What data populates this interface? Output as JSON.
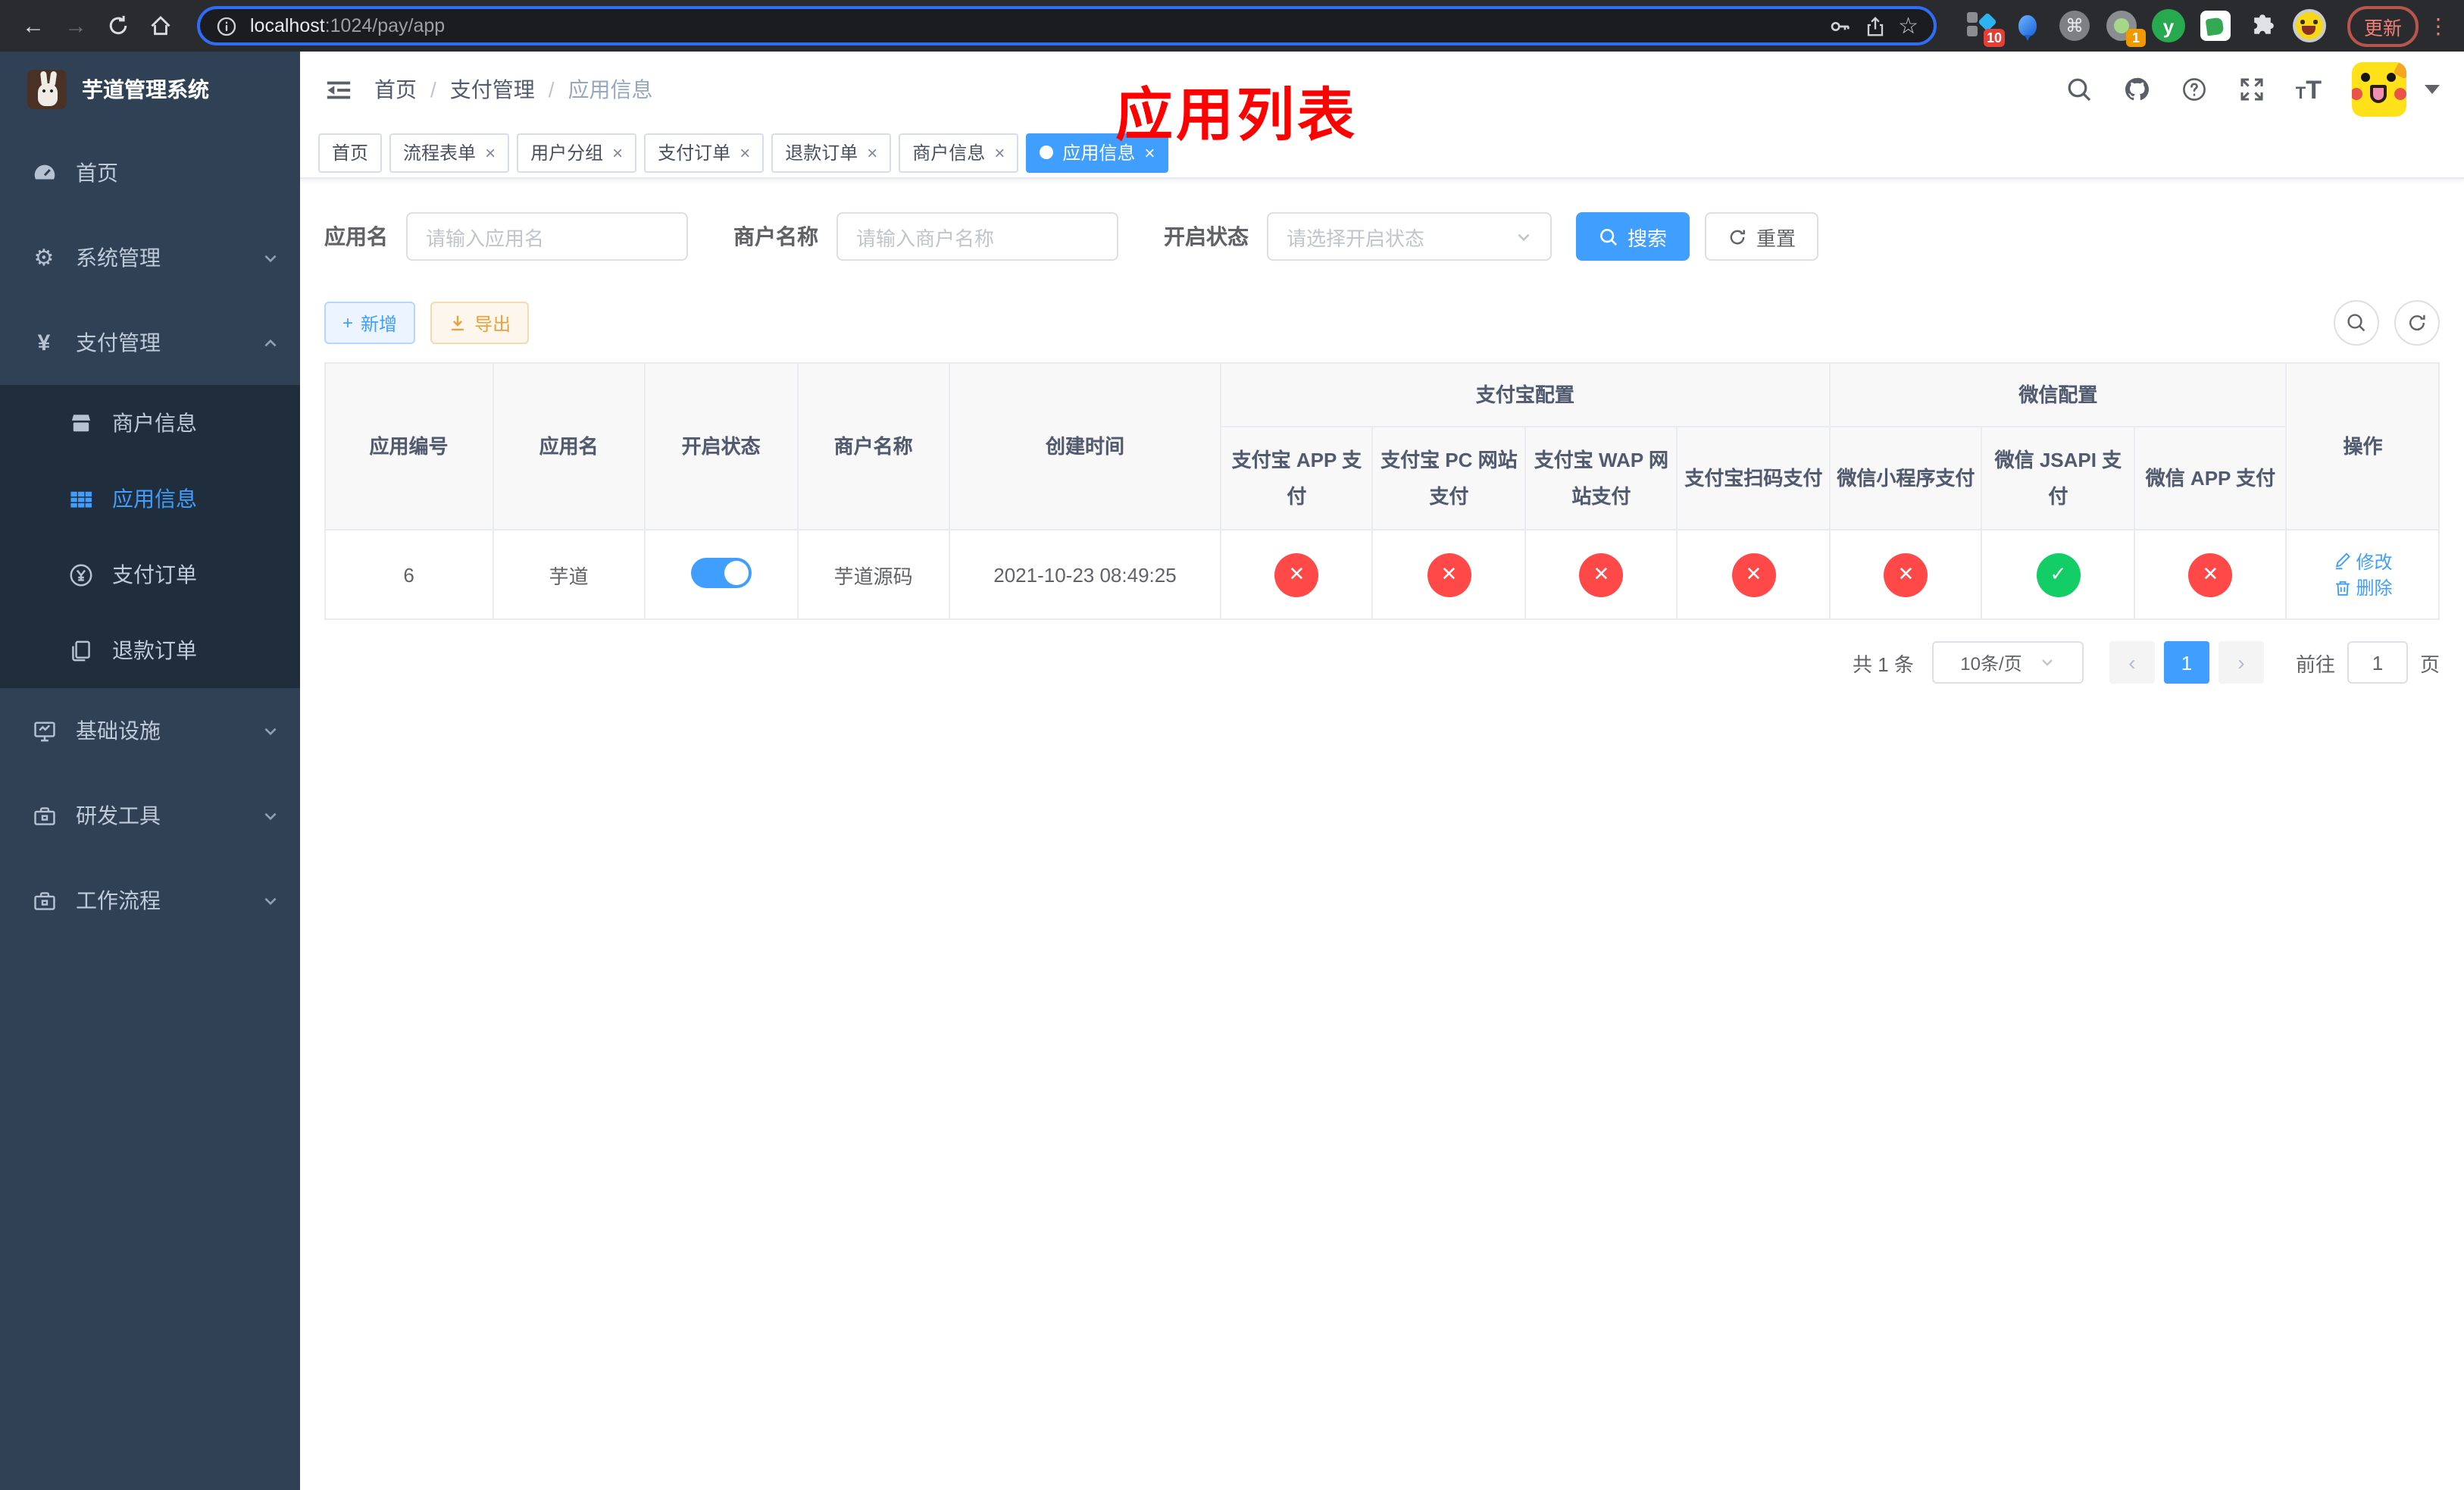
{
  "browser": {
    "url_host": "localhost",
    "url_rest": ":1024/pay/app",
    "ext_badge_sketch": "10",
    "ext_badge_record": "1",
    "ext_y_letter": "y",
    "update_label": "更新"
  },
  "icons": {
    "back": "←",
    "forward": "→",
    "star": "☆",
    "command": "⌘",
    "more": "⋮",
    "gear": "⚙",
    "yen": "¥",
    "plus": "+",
    "close": "×",
    "slash": "/",
    "question": "?",
    "font_small": "T",
    "font_large": "T",
    "prev": "‹",
    "next": "›"
  },
  "sidebar": {
    "title": "芋道管理系统",
    "items": [
      {
        "label": "首页"
      },
      {
        "label": "系统管理"
      },
      {
        "label": "支付管理"
      },
      {
        "label": "商户信息"
      },
      {
        "label": "应用信息"
      },
      {
        "label": "支付订单"
      },
      {
        "label": "退款订单"
      },
      {
        "label": "基础设施"
      },
      {
        "label": "研发工具"
      },
      {
        "label": "工作流程"
      }
    ]
  },
  "header": {
    "breadcrumb": [
      "首页",
      "支付管理",
      "应用信息"
    ],
    "annotation": "应用列表"
  },
  "tabs": [
    {
      "label": "首页"
    },
    {
      "label": "流程表单"
    },
    {
      "label": "用户分组"
    },
    {
      "label": "支付订单"
    },
    {
      "label": "退款订单"
    },
    {
      "label": "商户信息"
    },
    {
      "label": "应用信息"
    }
  ],
  "filter": {
    "app_name_label": "应用名",
    "app_name_placeholder": "请输入应用名",
    "merchant_label": "商户名称",
    "merchant_placeholder": "请输入商户名称",
    "status_label": "开启状态",
    "status_placeholder": "请选择开启状态",
    "search_label": "搜索",
    "reset_label": "重置"
  },
  "toolbar": {
    "add_label": "新增",
    "export_label": "导出"
  },
  "table": {
    "group_headers": {
      "alipay": "支付宝配置",
      "wechat": "微信配置"
    },
    "columns": [
      "应用编号",
      "应用名",
      "开启状态",
      "商户名称",
      "创建时间"
    ],
    "pay_columns": [
      "支付宝 APP 支付",
      "支付宝 PC 网站支付",
      "支付宝 WAP 网站支付",
      "支付宝扫码支付",
      "微信小程序支付",
      "微信 JSAPI 支付",
      "微信 APP 支付"
    ],
    "actions_header": "操作",
    "rows": [
      {
        "id": "6",
        "name": "芋道",
        "enabled": "on",
        "merchant": "芋道源码",
        "created": "2021-10-23 08:49:25",
        "statuses": [
          {
            "state": "no",
            "glyph": "✕"
          },
          {
            "state": "no",
            "glyph": "✕"
          },
          {
            "state": "no",
            "glyph": "✕"
          },
          {
            "state": "no",
            "glyph": "✕"
          },
          {
            "state": "no",
            "glyph": "✕"
          },
          {
            "state": "yes",
            "glyph": "✓"
          },
          {
            "state": "no",
            "glyph": "✕"
          }
        ],
        "edit_label": "修改",
        "delete_label": "删除"
      }
    ]
  },
  "pagination": {
    "total": "共 1 条",
    "page_size": "10条/页",
    "page": "1",
    "goto_prefix": "前往",
    "goto_value": "1",
    "goto_suffix": "页"
  },
  "colors": {
    "primary": "#409eff",
    "success": "#13ce66",
    "danger": "#ff4949",
    "sidebar_bg": "#304156",
    "submenu_bg": "#1f2d3d",
    "annotation": "#fe0000"
  }
}
